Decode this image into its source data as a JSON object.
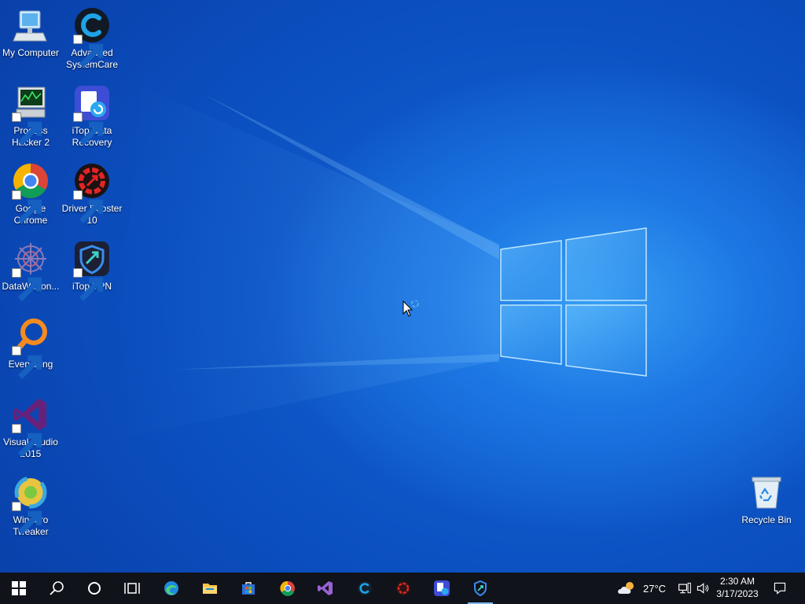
{
  "desktop": {
    "icons": [
      {
        "label_1": "My Computer",
        "label_2": ""
      },
      {
        "label_1": "Advanced",
        "label_2": "SystemCare"
      },
      {
        "label_1": "Process",
        "label_2": "Hacker 2"
      },
      {
        "label_1": "iTop Data",
        "label_2": "Recovery"
      },
      {
        "label_1": "Google",
        "label_2": "Chrome"
      },
      {
        "label_1": "Driver Booster",
        "label_2": "10"
      },
      {
        "label_1": "DataWagon...",
        "label_2": ""
      },
      {
        "label_1": "iTop VPN",
        "label_2": ""
      },
      {
        "label_1": "Everything",
        "label_2": ""
      },
      {
        "label_1": "Visual Studio",
        "label_2": "2015"
      },
      {
        "label_1": "Winaero",
        "label_2": "Tweaker"
      },
      {
        "label_1": "Recycle Bin",
        "label_2": ""
      }
    ]
  },
  "taskbar": {
    "weather_temp": "27°C",
    "clock_time": "2:30 AM",
    "clock_date": "3/17/2023",
    "pinned": [
      "start-icon",
      "search-icon",
      "cortana-icon",
      "task-view-icon",
      "edge-icon",
      "file-explorer-icon",
      "microsoft-store-icon",
      "chrome-icon",
      "visual-studio-icon",
      "advanced-systemcare-icon",
      "driver-booster-icon",
      "itop-data-recovery-icon",
      "itop-vpn-icon"
    ]
  },
  "colors": {
    "taskbar_bg": "#10131a",
    "wallpaper_blue": "#0b4fc0",
    "accent_light": "#3aa0f5"
  }
}
